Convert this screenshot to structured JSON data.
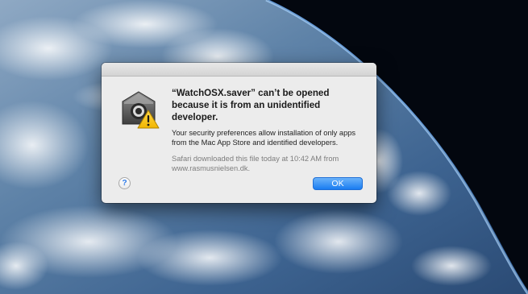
{
  "dialog": {
    "title": "“WatchOSX.saver” can’t be opened because it is from an unidentified developer.",
    "message": "Your security preferences allow installation of only apps from the Mac App Store and identified developers.",
    "note": "Safari downloaded this file today at 10:42 AM from www.rasmusnielsen.dk.",
    "help_label": "?",
    "ok_label": "OK"
  },
  "icons": {
    "app": "gatekeeper-lock-icon",
    "warning": "warning-triangle-icon",
    "help": "help-icon"
  },
  "colors": {
    "accent": "#197cf1",
    "warning": "#f7c600",
    "dialog_background": "#ececec"
  }
}
